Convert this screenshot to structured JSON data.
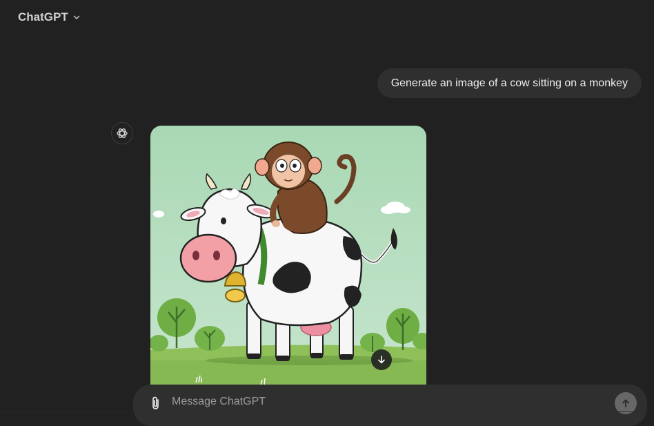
{
  "header": {
    "model_name": "ChatGPT",
    "chevron_icon": "chevron-down-icon"
  },
  "conversation": {
    "user_message": "Generate an image of a cow sitting on a monkey",
    "assistant": {
      "avatar_icon": "openai-logo-icon",
      "image_subject": "cartoon cow with a monkey on its back in a green meadow",
      "download_icon": "download-arrow-icon"
    }
  },
  "composer": {
    "placeholder": "Message ChatGPT",
    "value": "",
    "attach_icon": "paperclip-icon",
    "send_icon": "arrow-up-icon"
  },
  "colors": {
    "background": "#212121",
    "bubble": "#2f2f2f",
    "text": "#ececec",
    "placeholder": "#9b9b9b"
  }
}
